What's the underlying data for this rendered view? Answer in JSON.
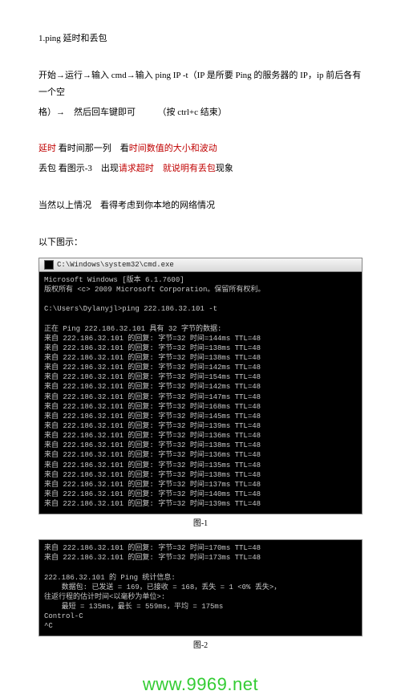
{
  "doc": {
    "heading": "1.ping 延时和丢包",
    "p1_a": "开始→运行→输入 cmd→输入 ping  IP  -t（IP 是所要 Ping 的服务器的 IP，ip 前后各有一个空",
    "p1_b": "格）→　然后回车键即可　　　（按 ctrl+c  结束）",
    "p2_pre": "延时",
    "p2_mid": " 看时间那一列　看",
    "p2_red": "时间数值的大小和波动",
    "p3_a": "丢包 看图示-3　出现",
    "p3_red1": "请求超时",
    "p3_gap": "　",
    "p3_red2": "就说明有丢包",
    "p3_tail": "现象",
    "p4": "当然以上情况　看得考虑到你本地的网络情况",
    "p5": "以下图示：",
    "caption1": "图-1",
    "caption2": "图-2"
  },
  "term1": {
    "title": "C:\\Windows\\system32\\cmd.exe",
    "lines": [
      "Microsoft Windows [版本 6.1.7600]",
      "版权所有 <c> 2009 Microsoft Corporation。保留所有权利。",
      "",
      "C:\\Users\\Dylanyjl>ping 222.186.32.101 -t",
      "",
      "正在 Ping 222.186.32.101 具有 32 字节的数据:",
      "来自 222.186.32.101 的回复: 字节=32 时间=144ms TTL=48",
      "来自 222.186.32.101 的回复: 字节=32 时间=138ms TTL=48",
      "来自 222.186.32.101 的回复: 字节=32 时间=138ms TTL=48",
      "来自 222.186.32.101 的回复: 字节=32 时间=142ms TTL=48",
      "来自 222.186.32.101 的回复: 字节=32 时间=154ms TTL=48",
      "来自 222.186.32.101 的回复: 字节=32 时间=142ms TTL=48",
      "来自 222.186.32.101 的回复: 字节=32 时间=147ms TTL=48",
      "来自 222.186.32.101 的回复: 字节=32 时间=168ms TTL=48",
      "来自 222.186.32.101 的回复: 字节=32 时间=145ms TTL=48",
      "来自 222.186.32.101 的回复: 字节=32 时间=139ms TTL=48",
      "来自 222.186.32.101 的回复: 字节=32 时间=136ms TTL=48",
      "来自 222.186.32.101 的回复: 字节=32 时间=138ms TTL=48",
      "来自 222.186.32.101 的回复: 字节=32 时间=136ms TTL=48",
      "来自 222.186.32.101 的回复: 字节=32 时间=135ms TTL=48",
      "来自 222.186.32.101 的回复: 字节=32 时间=138ms TTL=48",
      "来自 222.186.32.101 的回复: 字节=32 时间=137ms TTL=48",
      "来自 222.186.32.101 的回复: 字节=32 时间=140ms TTL=48",
      "来自 222.186.32.101 的回复: 字节=32 时间=139ms TTL=48"
    ]
  },
  "term2": {
    "lines": [
      "来自 222.186.32.101 的回复: 字节=32 时间=170ms TTL=48",
      "来自 222.186.32.101 的回复: 字节=32 时间=173ms TTL=48",
      "",
      "222.186.32.101 的 Ping 统计信息:",
      "    数据包: 已发送 = 169，已接收 = 168，丢失 = 1 <0% 丢失>，",
      "往返行程的估计时间<以毫秒为单位>:",
      "    最短 = 135ms，最长 = 559ms，平均 = 175ms",
      "Control-C",
      "^C"
    ]
  },
  "watermark": "www.9969.net"
}
